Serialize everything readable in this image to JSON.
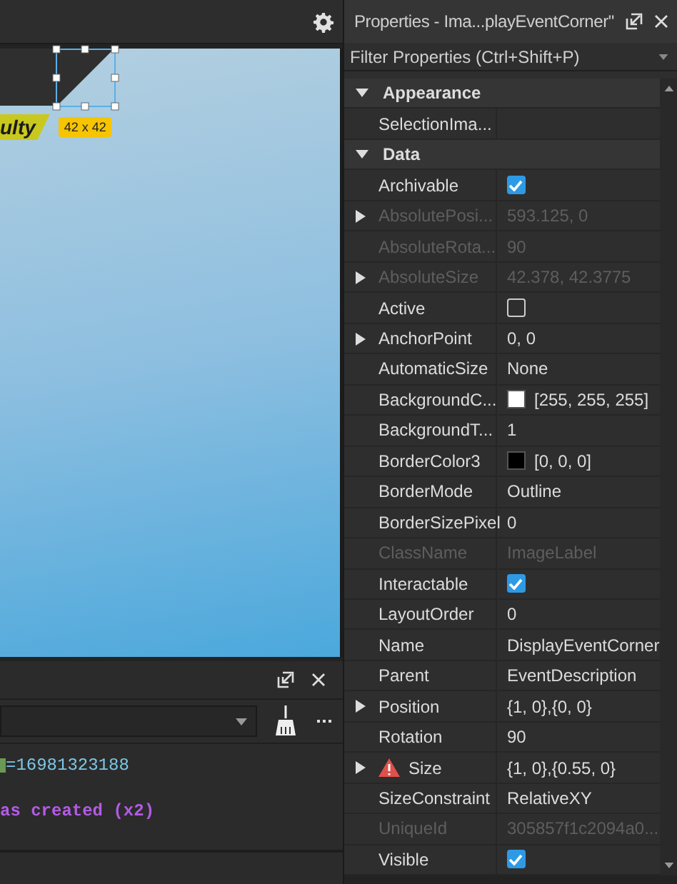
{
  "viewport": {
    "banner_text": "ulty",
    "size_badge": "42 x 42"
  },
  "output": {
    "lines": [
      {
        "kind": "id",
        "text": "=16981323188"
      },
      {
        "kind": "event",
        "text": "as created (x2)"
      }
    ]
  },
  "properties": {
    "title": "Properties - Ima...playEventCorner\"",
    "filter": {
      "placeholder": "Filter Properties (Ctrl+Shift+P)"
    },
    "rows": [
      {
        "kind": "category",
        "name": "Appearance",
        "expanded": true
      },
      {
        "kind": "text",
        "name": "SelectionIma...",
        "value": null
      },
      {
        "kind": "category",
        "name": "Data",
        "expanded": true
      },
      {
        "kind": "check",
        "name": "Archivable",
        "checked": true
      },
      {
        "kind": "text",
        "name": "AbsolutePosi...",
        "value": "593.125, 0",
        "expandable": true,
        "disabled": true
      },
      {
        "kind": "text",
        "name": "AbsoluteRota...",
        "value": "90",
        "disabled": true
      },
      {
        "kind": "text",
        "name": "AbsoluteSize",
        "value": "42.378, 42.3775",
        "expandable": true,
        "disabled": true
      },
      {
        "kind": "check",
        "name": "Active",
        "checked": false
      },
      {
        "kind": "text",
        "name": "AnchorPoint",
        "value": "0, 0",
        "expandable": true
      },
      {
        "kind": "text",
        "name": "AutomaticSize",
        "value": "None"
      },
      {
        "kind": "color",
        "name": "BackgroundC...",
        "value": "[255, 255, 255]",
        "color": "#ffffff"
      },
      {
        "kind": "text",
        "name": "BackgroundT...",
        "value": "1"
      },
      {
        "kind": "color",
        "name": "BorderColor3",
        "value": "[0, 0, 0]",
        "color": "#000000"
      },
      {
        "kind": "text",
        "name": "BorderMode",
        "value": "Outline"
      },
      {
        "kind": "text",
        "name": "BorderSizePixel",
        "value": "0"
      },
      {
        "kind": "text",
        "name": "ClassName",
        "value": "ImageLabel",
        "disabled": true
      },
      {
        "kind": "check",
        "name": "Interactable",
        "checked": true
      },
      {
        "kind": "text",
        "name": "LayoutOrder",
        "value": "0"
      },
      {
        "kind": "text",
        "name": "Name",
        "value": "DisplayEventCorner"
      },
      {
        "kind": "text",
        "name": "Parent",
        "value": "EventDescription"
      },
      {
        "kind": "text",
        "name": "Position",
        "value": "{1, 0},{0, 0}",
        "expandable": true
      },
      {
        "kind": "text",
        "name": "Rotation",
        "value": "90"
      },
      {
        "kind": "text",
        "name": "Size",
        "value": "{1, 0},{0.55, 0}",
        "expandable": true,
        "warning": true
      },
      {
        "kind": "text",
        "name": "SizeConstraint",
        "value": "RelativeXY"
      },
      {
        "kind": "text",
        "name": "UniqueId",
        "value": "305857f1c2094a0...",
        "disabled": true
      },
      {
        "kind": "check",
        "name": "Visible",
        "checked": true
      }
    ]
  }
}
